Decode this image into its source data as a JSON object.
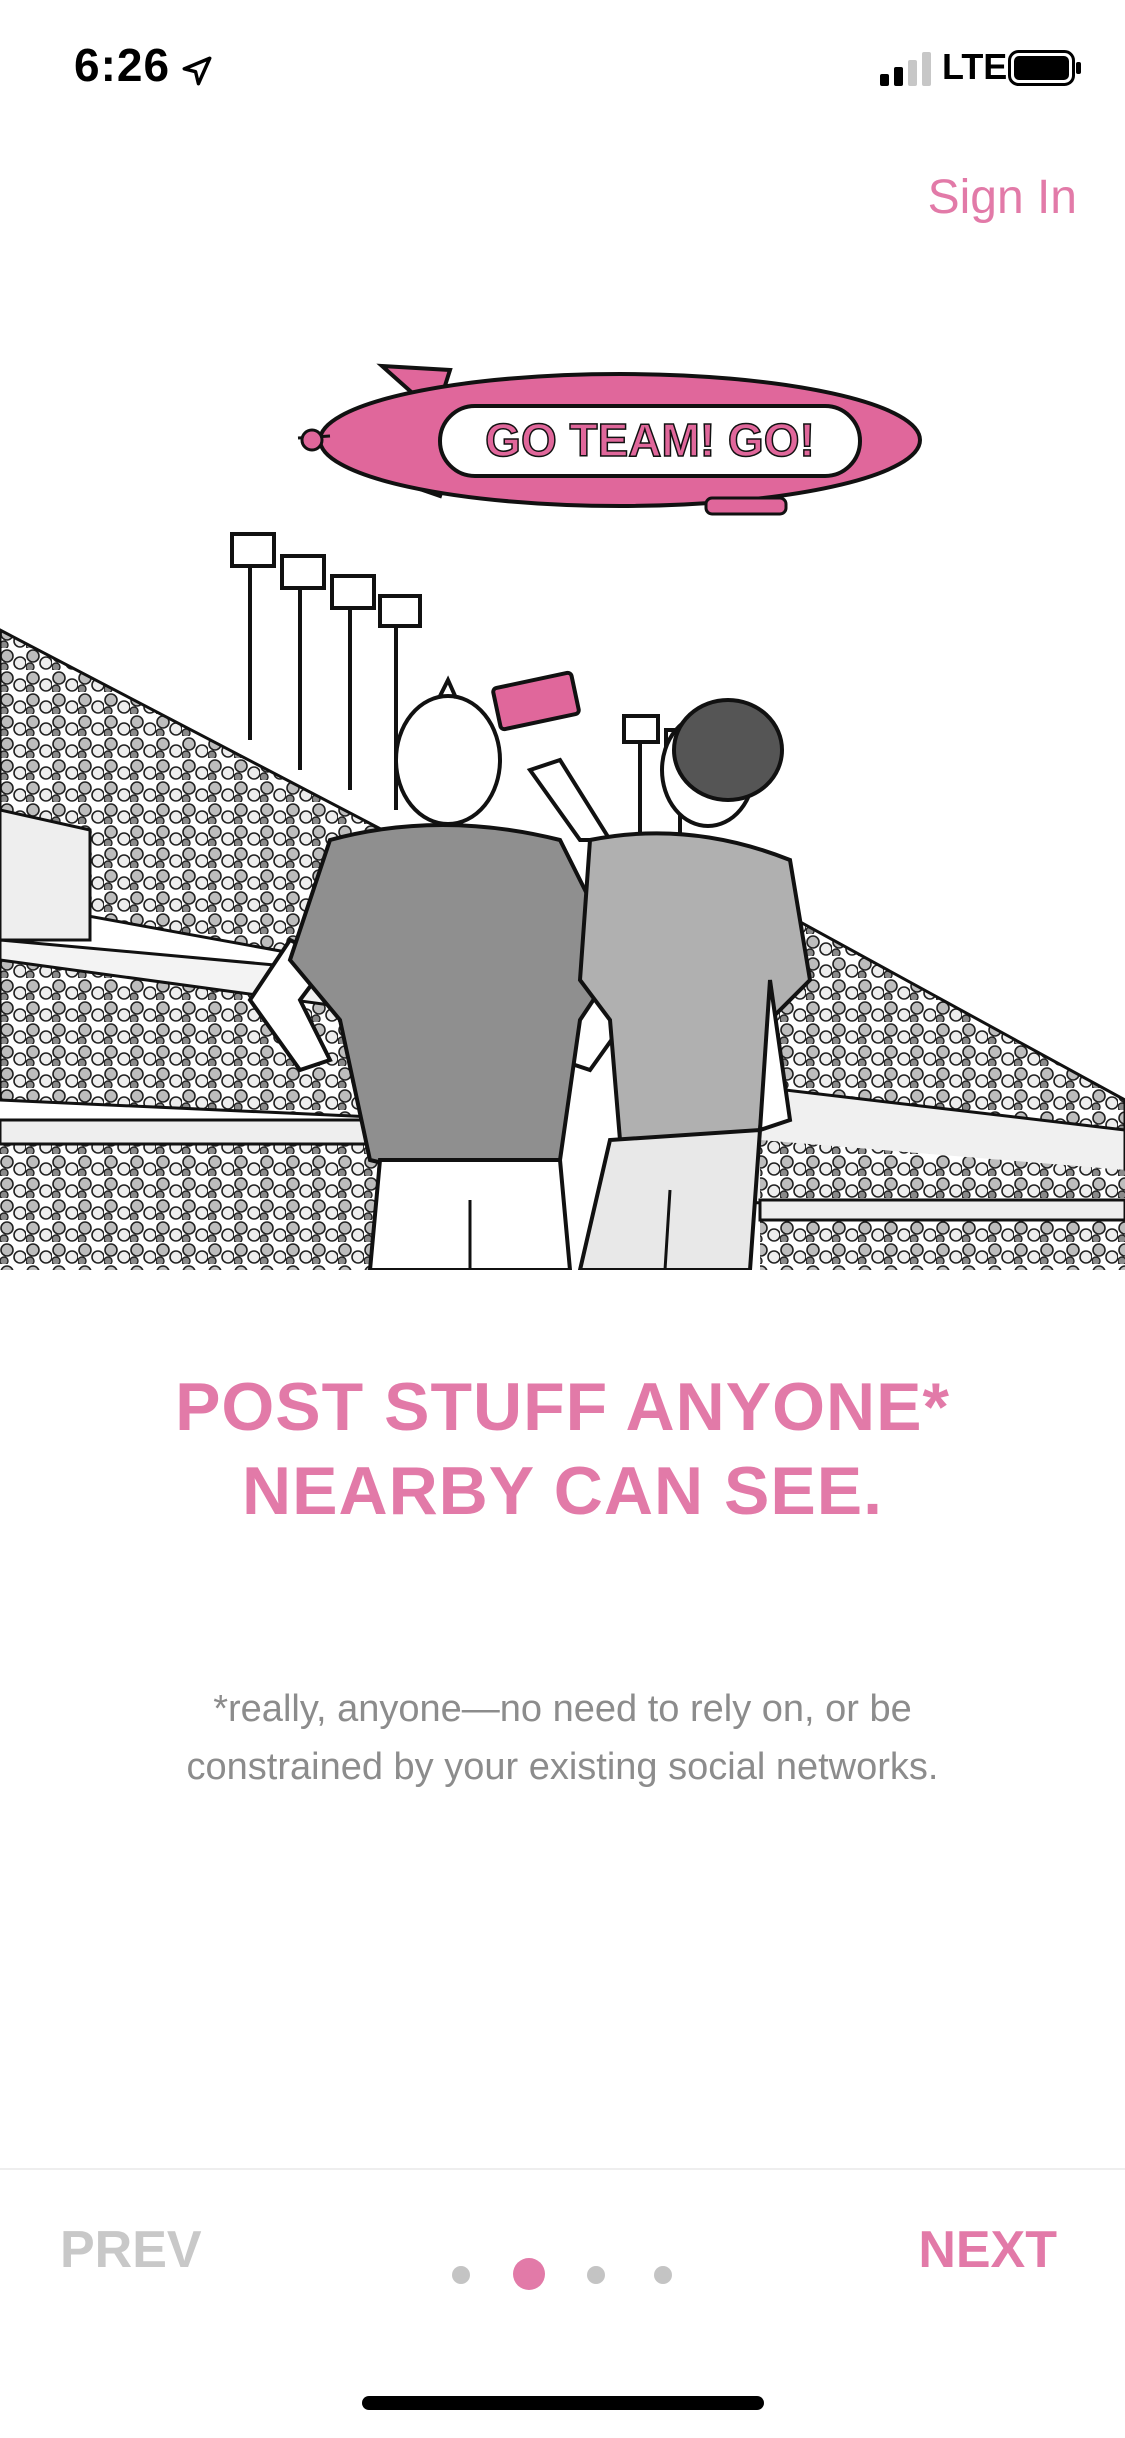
{
  "status_bar": {
    "time": "6:26",
    "carrier": "LTE",
    "icons": [
      "location-arrow-icon",
      "signal-icon",
      "battery-icon"
    ]
  },
  "header": {
    "sign_in_label": "Sign In"
  },
  "illustration": {
    "blimp_text": "GO TEAM! GO!"
  },
  "content": {
    "headline_line1": "POST STUFF ANYONE*",
    "headline_line2": "NEARBY CAN SEE.",
    "subtext_line1": "*really, anyone—no need to rely on, or be",
    "subtext_line2": "constrained by your existing social networks."
  },
  "navigation": {
    "prev_label": "PREV",
    "next_label": "NEXT",
    "page_count": 4,
    "current_page": 2
  },
  "colors": {
    "accent": "#e27aa8",
    "muted_text": "#8c8c8c",
    "disabled": "#c8c8c8"
  }
}
